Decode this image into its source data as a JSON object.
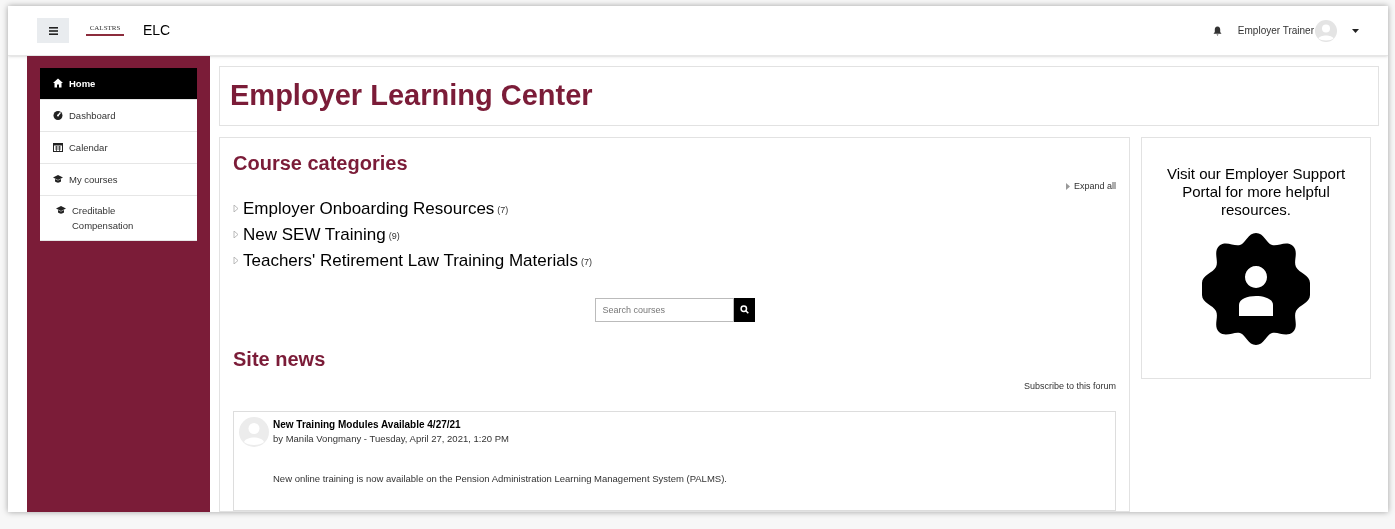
{
  "navbar": {
    "site_name": "ELC",
    "logo_text": "CALSTRS",
    "user_name": "Employer Trainer"
  },
  "sidebar": {
    "items": [
      {
        "label": "Home",
        "kind": "home",
        "selected": true
      },
      {
        "label": "Dashboard",
        "kind": "dashboard",
        "selected": false
      },
      {
        "label": "Calendar",
        "kind": "calendar",
        "selected": false
      },
      {
        "label": "My courses",
        "kind": "courses",
        "selected": false,
        "children": [
          {
            "label": "Creditable Compensation",
            "kind": "courses",
            "selected": false
          }
        ]
      }
    ]
  },
  "page_title": "Employer Learning Center",
  "course_categories": {
    "title": "Course categories",
    "expand_all": "Expand all",
    "categories": [
      {
        "name": "Employer Onboarding Resources",
        "count": "(7)",
        "expanded": false
      },
      {
        "name": "New SEW Training",
        "count": "(9)",
        "expanded": false
      },
      {
        "name": "Teachers' Retirement Law Training Materials",
        "count": "(7)",
        "expanded": false
      }
    ],
    "search": {
      "placeholder": "Search courses"
    }
  },
  "site_news": {
    "title": "Site news",
    "subscribe": "Subscribe to this forum",
    "posts": [
      {
        "title": "New Training Modules Available 4/27/21",
        "byline": "by Manila Vongmany - Tuesday, April 27, 2021, 1:20 PM",
        "body": "New online training is now available on the Pension Administration Learning Management System (PALMS)."
      }
    ]
  },
  "support_block": {
    "text": "Visit our Employer Support Portal for more helpful resources."
  }
}
